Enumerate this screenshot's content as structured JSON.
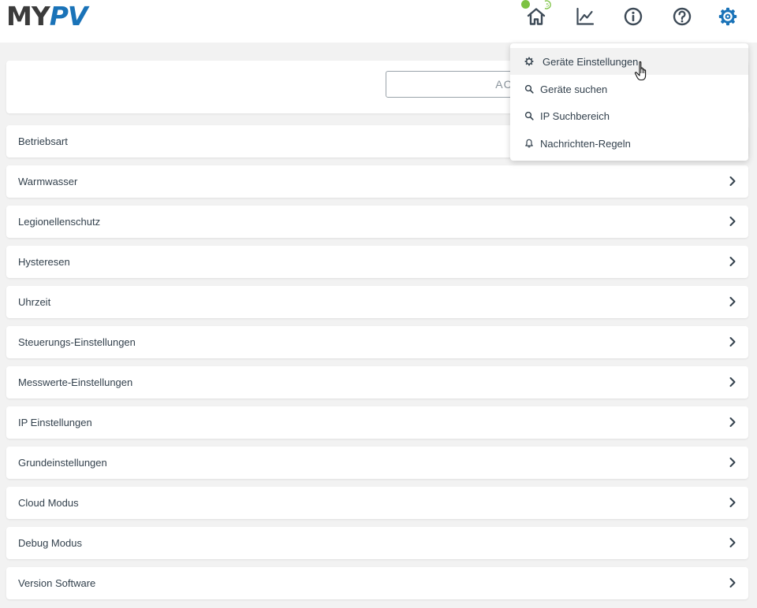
{
  "brand": {
    "logo_left": "MY",
    "logo_right": "PV"
  },
  "colors": {
    "accent": "#1a73b8",
    "icon": "#3d4a57",
    "status_online": "#7cc242",
    "text": "#33414d",
    "background": "#f2f2f2"
  },
  "header": {
    "status_badge": "5",
    "nav_icons": [
      {
        "name": "home-icon"
      },
      {
        "name": "chart-icon"
      },
      {
        "name": "info-icon"
      },
      {
        "name": "help-icon"
      },
      {
        "name": "gear-icon"
      }
    ]
  },
  "search": {
    "value": "AC"
  },
  "settings": {
    "items": [
      {
        "label": "Betriebsart"
      },
      {
        "label": "Warmwasser"
      },
      {
        "label": "Legionellenschutz"
      },
      {
        "label": "Hysteresen"
      },
      {
        "label": "Uhrzeit"
      },
      {
        "label": "Steuerungs-Einstellungen"
      },
      {
        "label": "Messwerte-Einstellungen"
      },
      {
        "label": "IP Einstellungen"
      },
      {
        "label": "Grundeinstellungen"
      },
      {
        "label": "Cloud Modus"
      },
      {
        "label": "Debug Modus"
      },
      {
        "label": "Version Software"
      }
    ]
  },
  "menu": {
    "items": [
      {
        "label": "Geräte Einstellungen",
        "icon": "gear-icon"
      },
      {
        "label": "Geräte suchen",
        "icon": "search-icon"
      },
      {
        "label": "IP Suchbereich",
        "icon": "search-icon"
      },
      {
        "label": "Nachrichten-Regeln",
        "icon": "bell-icon"
      }
    ]
  }
}
